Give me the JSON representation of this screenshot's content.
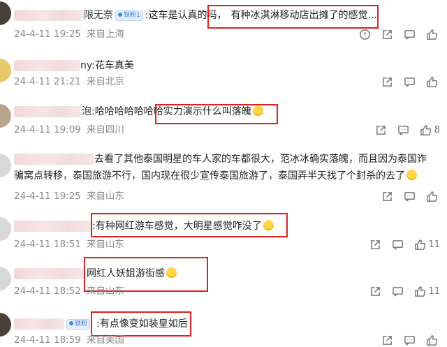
{
  "comments": [
    {
      "name_tail": "限无奈",
      "badge": "铁粉1",
      "text_prefix": ":这车是认真的吗，",
      "text_highlight": "有种冰淇淋移动店出摊了的感觉...",
      "date": "24-4-11 19:25",
      "location": "来自上海",
      "likes": "",
      "has_report": true
    },
    {
      "name_tail": "ny:",
      "text_prefix": "花车真美",
      "date": "24-4-11 21:21",
      "location": "来自北京",
      "likes": ""
    },
    {
      "name_tail": "泡:",
      "text_prefix": "哈哈哈哈哈哈哈",
      "text_highlight": "实力演示什么叫落魄",
      "date": "24-4-11 19:09",
      "location": "来自四川",
      "likes": "8"
    },
    {
      "text_line1": "去看了其他泰国明星的车人家的车都很大，范冰冰确实落魄，而且因为泰国诈",
      "text_line2": "骗窝点转移，泰国旅游不行，国内现在很少宣传泰国旅游了，泰国弄半天找了个封杀的去了",
      "date": "24-4-11 19:25",
      "location": "来自山东",
      "likes": ""
    },
    {
      "text_highlight": ":有种网红游车感觉，大明星感觉咋没了",
      "date": "24-4-11 18:51",
      "location": "来自山东",
      "likes": "11"
    },
    {
      "text_highlight": "网红人妖姐游街感",
      "date": "24-4-11 18:52",
      "location": "来自山东",
      "likes": "11"
    },
    {
      "badge": "铁粉",
      "text_highlight": ":有点像变如装皇如后",
      "date": "24-4-11 18:59",
      "location": "来自美国",
      "likes": ""
    }
  ],
  "icons": {
    "report": "report-icon",
    "share": "share-icon",
    "reply": "comment-icon",
    "like": "thumbs-up-icon"
  },
  "colors": {
    "highlight_border": "#e02020",
    "meta_text": "#8a8a8a",
    "badge_bg": "#e3efff"
  }
}
